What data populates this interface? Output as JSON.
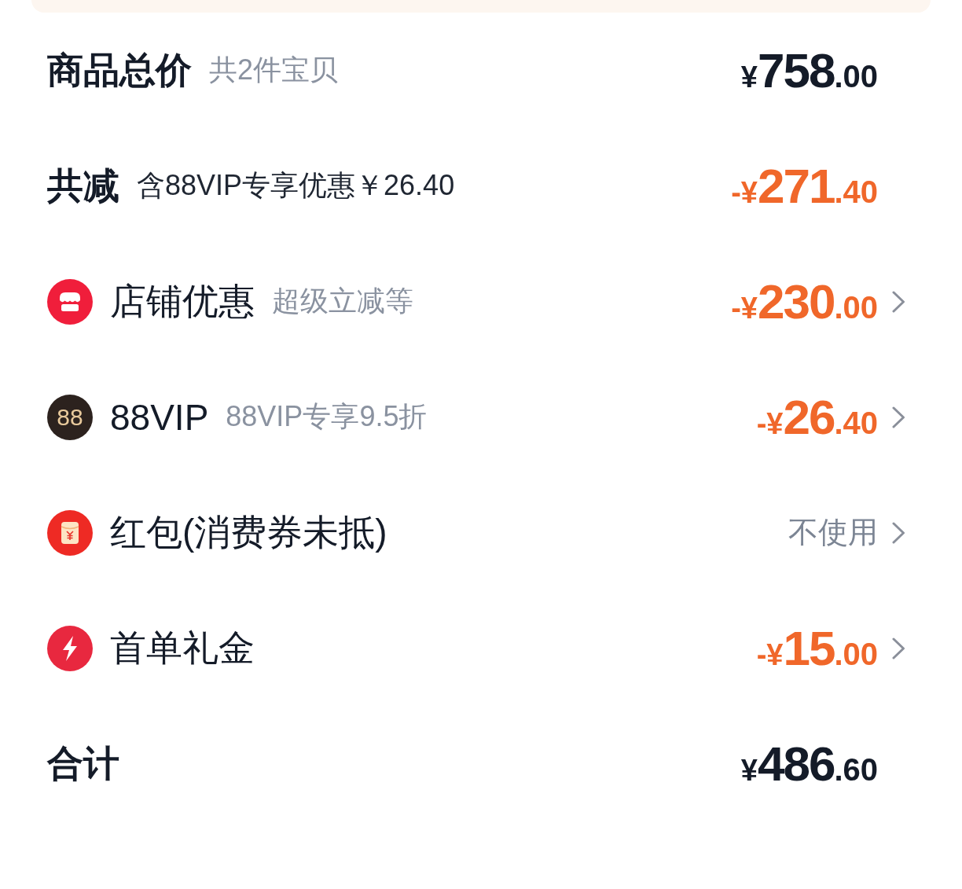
{
  "rows": [
    {
      "kind": "summary",
      "title": "商品总价",
      "note": {
        "text": "共2件宝贝",
        "muted": true
      },
      "value": {
        "kind": "amount",
        "discount": false,
        "prefix": "¥",
        "whole": "758",
        "fraction": ".00"
      },
      "chevron": false
    },
    {
      "kind": "summary",
      "title": "共减",
      "note": {
        "text": "含88VIP专享优惠￥26.40",
        "muted": false
      },
      "value": {
        "kind": "amount",
        "discount": true,
        "prefix": "-¥",
        "whole": "271",
        "fraction": ".40"
      },
      "chevron": false
    },
    {
      "kind": "store",
      "title": "店铺优惠",
      "note": {
        "text": "超级立减等",
        "muted": true
      },
      "value": {
        "kind": "amount",
        "discount": true,
        "prefix": "-¥",
        "whole": "230",
        "fraction": ".00"
      },
      "chevron": true
    },
    {
      "kind": "vip",
      "badge": "88",
      "title": "88VIP",
      "note": {
        "text": "88VIP专享9.5折",
        "muted": true
      },
      "value": {
        "kind": "amount",
        "discount": true,
        "prefix": "-¥",
        "whole": "26",
        "fraction": ".40"
      },
      "chevron": true
    },
    {
      "kind": "envelope",
      "title": "红包(消费券未抵)",
      "value": {
        "kind": "label",
        "text": "不使用"
      },
      "chevron": true
    },
    {
      "kind": "bolt",
      "title": "首单礼金",
      "value": {
        "kind": "amount",
        "discount": true,
        "prefix": "-¥",
        "whole": "15",
        "fraction": ".00"
      },
      "chevron": true
    },
    {
      "kind": "summary",
      "title": "合计",
      "value": {
        "kind": "amount",
        "discount": false,
        "prefix": "¥",
        "whole": "486",
        "fraction": ".60"
      },
      "chevron": false
    }
  ]
}
